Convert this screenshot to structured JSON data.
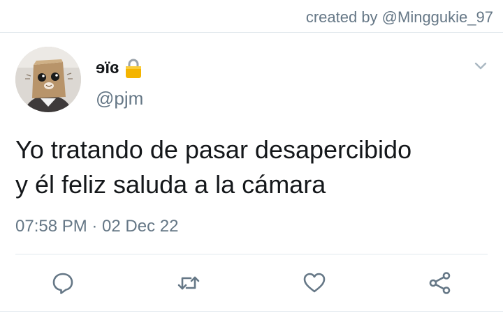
{
  "credit": "created by @Minggukie_97",
  "author": {
    "display_name": "ɘïɞ",
    "handle": "@pjm",
    "lock_icon": "lock-icon",
    "avatar": "avatar"
  },
  "menu_icon": "chevron-down-icon",
  "tweet": {
    "lines": [
      "Yo tratando de pasar desapercibido",
      "y él feliz saluda a la cámara"
    ],
    "timestamp": "07:58 PM · 02 Dec 22"
  },
  "actions": [
    {
      "icon": "reply-icon"
    },
    {
      "icon": "retweet-icon"
    },
    {
      "icon": "like-icon"
    },
    {
      "icon": "share-icon"
    }
  ],
  "colors": {
    "icon_gray": "#657786",
    "text": "#14171a",
    "divider": "#e1e8ed",
    "lock_gold": "#f4b400"
  }
}
